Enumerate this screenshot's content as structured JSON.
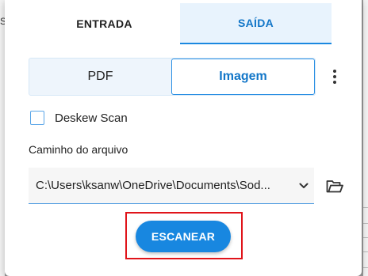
{
  "background": {
    "left_fragment": "S"
  },
  "tabs": [
    {
      "label": "ENTRADA",
      "active": false
    },
    {
      "label": "SAÍDA",
      "active": true
    }
  ],
  "output_format": {
    "options": [
      {
        "label": "PDF",
        "selected": false
      },
      {
        "label": "Imagem",
        "selected": true
      }
    ],
    "more_icon": "more-vertical-icon"
  },
  "deskew": {
    "label": "Deskew Scan",
    "checked": false
  },
  "file_path": {
    "label": "Caminho do arquivo",
    "value": "C:\\Users\\ksanw\\OneDrive\\Documents\\Sod...",
    "dropdown_icon": "chevron-down-icon",
    "browse_icon": "folder-open-icon"
  },
  "scan_button": {
    "label": "ESCANEAR"
  },
  "colors": {
    "accent": "#1887e0",
    "tab_active_bg": "#e8f3fd",
    "highlight": "#e0141a"
  }
}
